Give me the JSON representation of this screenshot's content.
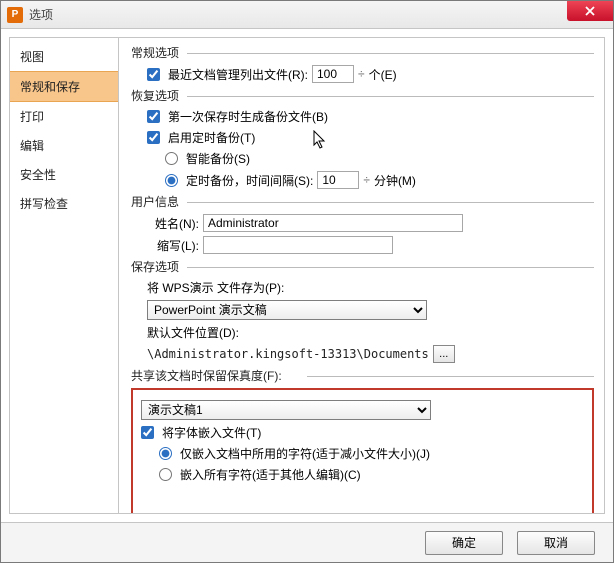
{
  "window": {
    "title": "选项",
    "close_label": "X"
  },
  "sidebar": {
    "items": [
      {
        "label": "视图"
      },
      {
        "label": "常规和保存"
      },
      {
        "label": "打印"
      },
      {
        "label": "编辑"
      },
      {
        "label": "安全性"
      },
      {
        "label": "拼写检查"
      }
    ],
    "selected": 1
  },
  "general": {
    "group_label": "常规选项",
    "recent_files_label": "最近文档管理列出文件(R):",
    "recent_files_value": "100",
    "recent_files_unit": "个(E)"
  },
  "recovery": {
    "group_label": "恢复选项",
    "first_save_backup": "第一次保存时生成备份文件(B)",
    "enable_timed_backup": "启用定时备份(T)",
    "smart_backup": "智能备份(S)",
    "timed_backup_label": "定时备份，时间间隔(S):",
    "timed_backup_value": "10",
    "timed_backup_unit": "分钟(M)"
  },
  "user": {
    "group_label": "用户信息",
    "name_label": "姓名(N):",
    "name_value": "Administrator",
    "initials_label": "缩写(L):",
    "initials_value": ""
  },
  "save": {
    "group_label": "保存选项",
    "save_as_label": "将 WPS演示 文件存为(P):",
    "save_as_value": "PowerPoint 演示文稿",
    "default_path_label": "默认文件位置(D):",
    "default_path_value": "\\Administrator.kingsoft-13313\\Documents",
    "browse_label": "..."
  },
  "fidelity": {
    "group_label": "共享该文档时保留保真度(F):",
    "doc_select": "演示文稿1",
    "embed_fonts": "将字体嵌入文件(T)",
    "embed_used": "仅嵌入文档中所用的字符(适于减小文件大小)(J)",
    "embed_all": "嵌入所有字符(适于其他人编辑)(C)"
  },
  "footer": {
    "ok": "确定",
    "cancel": "取消"
  },
  "spinner_glyph": "÷"
}
